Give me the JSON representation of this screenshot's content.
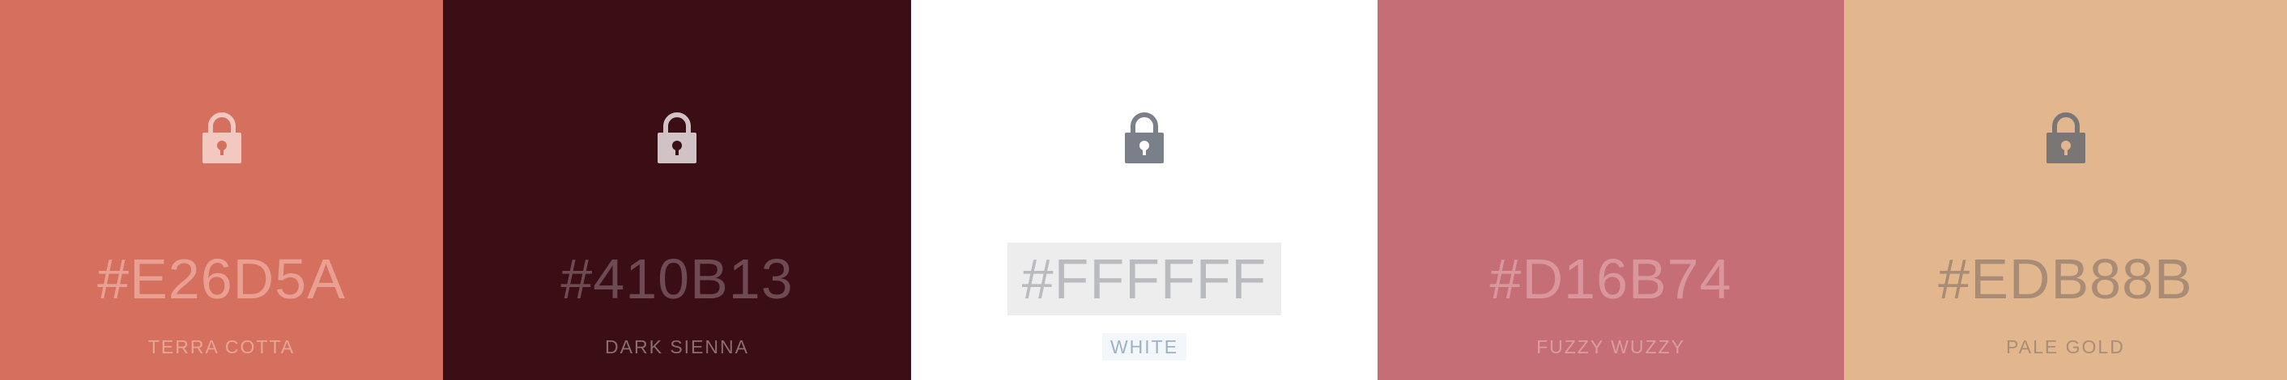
{
  "palette": {
    "swatches": [
      {
        "hex": "#E26D5A",
        "name": "TERRA COTTA",
        "background": "#D5705F",
        "text_color": "#E9A093",
        "name_color": "#E8A597",
        "lock_icon": "lock-icon",
        "lock_body_color": "#F2C8C0",
        "lock_hole_color": "#D5705F"
      },
      {
        "hex": "#410B13",
        "name": "DARK SIENNA",
        "background": "#3B0E16",
        "text_color": "#6E4A52",
        "name_color": "#8B6E74",
        "lock_icon": "lock-icon",
        "lock_body_color": "#D1C2C5",
        "lock_hole_color": "#3B0E16"
      },
      {
        "hex": "#FFFFFF",
        "name": "WHITE",
        "background": "#FFFFFF",
        "text_color": "#B9BBBE",
        "name_color": "#9EB0C8",
        "lock_icon": "lock-icon",
        "lock_body_color": "#7A7F89",
        "lock_hole_color": "#FFFFFF",
        "hex_highlight": "#EDEDED",
        "name_highlight": "#F3F7FB"
      },
      {
        "hex": "#D16B74",
        "name": "FUZZY WUZZY",
        "background": "#C66E75",
        "text_color": "#D9979D",
        "name_color": "#DA9DA2",
        "lock_icon": "",
        "lock_body_color": "",
        "lock_hole_color": ""
      },
      {
        "hex": "#EDB88B",
        "name": "PALE GOLD",
        "background": "#E3B78E",
        "text_color": "#A98C75",
        "name_color": "#A98D78",
        "lock_icon": "lock-icon",
        "lock_body_color": "#7A7676",
        "lock_hole_color": "#E3B78E"
      }
    ]
  }
}
